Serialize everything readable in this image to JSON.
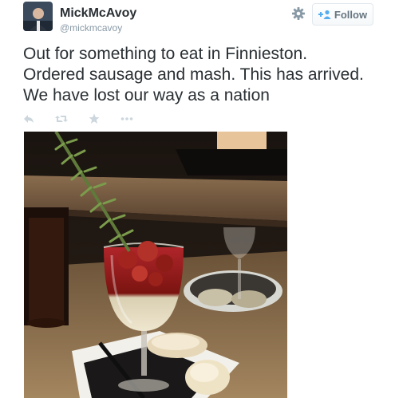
{
  "tweet": {
    "author_name": "MickMcAvoy",
    "author_handle": "@mickmcavoy",
    "follow_label": "Follow",
    "text_lines": [
      "Out for something to eat in Finnieston.",
      "Ordered sausage and mash. This has arrived.",
      "We have lost our way as a nation"
    ]
  },
  "icons": {
    "settings": "gear-icon",
    "follow": "add-user-icon",
    "reply": "reply-icon",
    "retweet": "retweet-icon",
    "favorite": "star-icon",
    "more": "more-icon"
  },
  "colors": {
    "text": "#292f33",
    "muted": "#8899a6",
    "follow_accent": "#55acee",
    "action_icon": "#ccd6dd"
  }
}
